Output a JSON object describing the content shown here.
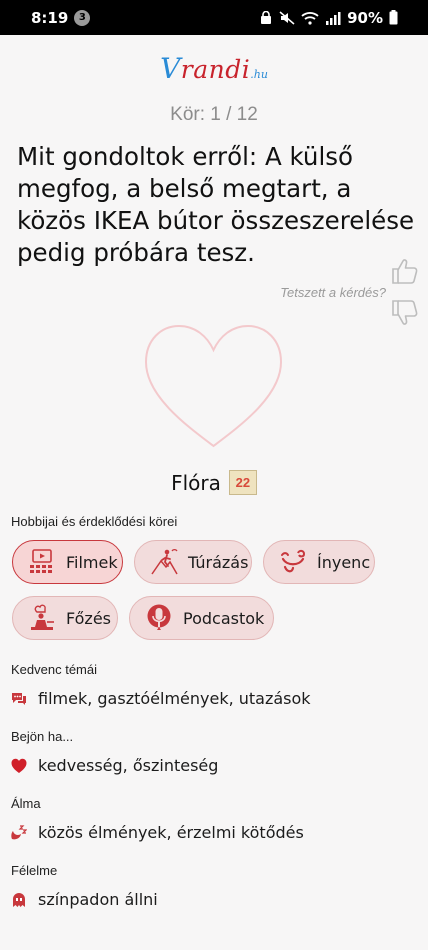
{
  "status_bar": {
    "time": "8:19",
    "notification_count": "3",
    "battery": "90%"
  },
  "logo": {
    "main": "randi",
    "v": "V",
    "suffix": ".hu"
  },
  "round_label": "Kör: 1 / 12",
  "question": "Mit gondoltok erről: A külső megfog, a belső megtart, a közös IKEA bútor összeszerelése pedig próbára tesz.",
  "feedback": {
    "prompt": "Tetszett a kérdés?"
  },
  "profile": {
    "name": "Flóra",
    "zodiac": "22"
  },
  "hobbies": {
    "title": "Hobbijai és érdeklődési körei",
    "items": [
      {
        "label": "Filmek",
        "icon": "cinema-icon",
        "active": true
      },
      {
        "label": "Túrázás",
        "icon": "hiking-icon",
        "active": false
      },
      {
        "label": "Ínyenc",
        "icon": "gourmet-icon",
        "active": false
      },
      {
        "label": "Főzés",
        "icon": "cooking-icon",
        "active": false
      },
      {
        "label": "Podcastok",
        "icon": "podcast-icon",
        "active": false
      }
    ]
  },
  "favorite_topics": {
    "title": "Kedvenc témái",
    "icon": "chat-bubbles-icon",
    "value": "filmek, gasztóélmények, utazások"
  },
  "attraction": {
    "title": "Bejön ha...",
    "icon": "heart-icon",
    "value": "kedvesség, őszinteség"
  },
  "dream": {
    "title": "Álma",
    "icon": "sleep-moon-icon",
    "value": "közös élmények, érzelmi kötődés"
  },
  "fear": {
    "title": "Félelme",
    "icon": "ghost-icon",
    "value": "színpadon állni"
  },
  "colors": {
    "accent": "#c8383d",
    "chip_bg": "#f2dcdc",
    "logo_blue": "#2a8bd6",
    "logo_red": "#c8232c",
    "heart_outline": "#f3c9cc"
  }
}
